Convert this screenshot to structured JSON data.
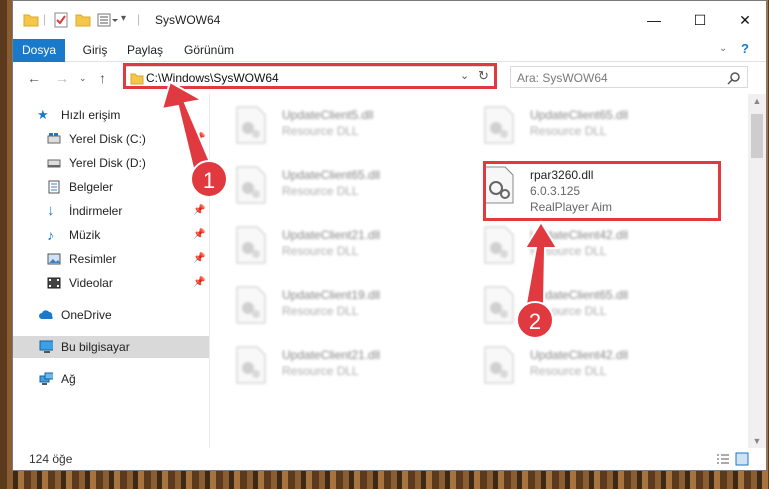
{
  "window": {
    "title": "SysWOW64"
  },
  "ribbon": {
    "tabs": [
      "Dosya",
      "Giriş",
      "Paylaş",
      "Görünüm"
    ]
  },
  "nav": {
    "address": "C:\\Windows\\SysWOW64",
    "search_placeholder": "Ara: SysWOW64"
  },
  "sidebar": {
    "items": [
      {
        "label": "Hızlı erişim",
        "icon": "star-icon"
      },
      {
        "label": "Yerel Disk (C:)",
        "icon": "drive-icon"
      },
      {
        "label": "Yerel Disk (D:)",
        "icon": "drive-icon"
      },
      {
        "label": "Belgeler",
        "icon": "documents-icon"
      },
      {
        "label": "İndirmeler",
        "icon": "download-icon"
      },
      {
        "label": "Müzik",
        "icon": "music-icon"
      },
      {
        "label": "Resimler",
        "icon": "pictures-icon"
      },
      {
        "label": "Videolar",
        "icon": "videos-icon"
      },
      {
        "label": "OneDrive",
        "icon": "cloud-icon"
      },
      {
        "label": "Bu bilgisayar",
        "icon": "computer-icon"
      },
      {
        "label": "Ağ",
        "icon": "network-icon"
      }
    ]
  },
  "files": [
    {
      "name": "UpdateClient5.dll",
      "type": "Resource DLL"
    },
    {
      "name": "UpdateClient65.dll",
      "type": "Resource DLL"
    },
    {
      "name": "UpdateClient65.dll",
      "type": "Resource DLL"
    },
    {
      "name": "UpdateClient21.dll",
      "type": "Resource DLL"
    },
    {
      "name": "UpdateClient42.dll",
      "type": "Resource DLL"
    },
    {
      "name": "UpdateClient19.dll",
      "type": "Resource DLL"
    },
    {
      "name": "UpdateClient65.dll",
      "type": "Resource DLL"
    },
    {
      "name": "UpdateClient21.dll",
      "type": "Resource DLL"
    },
    {
      "name": "UpdateClient42.dll",
      "type": "Resource DLL"
    }
  ],
  "highlighted_file": {
    "name": "rpar3260.dll",
    "version": "6.0.3.125",
    "description": "RealPlayer Aim"
  },
  "annotations": {
    "step1": "1",
    "step2": "2"
  },
  "status": {
    "count": "124 öğe"
  },
  "colors": {
    "accent": "#1979ca",
    "highlight": "#e0393f"
  }
}
